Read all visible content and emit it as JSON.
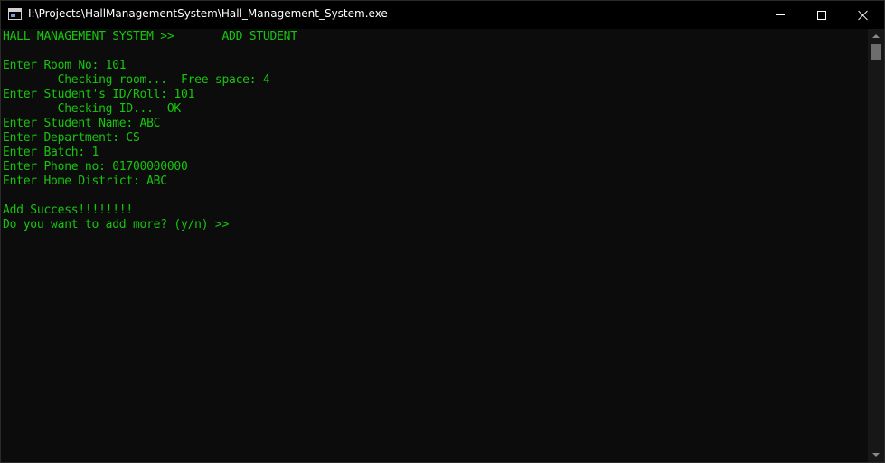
{
  "window": {
    "title": "I:\\Projects\\HallManagementSystem\\Hall_Management_System.exe",
    "icon": "console-app-icon"
  },
  "titlebar_buttons": {
    "minimize_icon": "minimize-icon",
    "maximize_icon": "maximize-icon",
    "close_icon": "close-icon"
  },
  "console": {
    "text_color": "#16c60c",
    "background_color": "#0c0c0c",
    "lines": [
      "HALL MANAGEMENT SYSTEM >>       ADD STUDENT",
      "",
      "Enter Room No: 101",
      "        Checking room...  Free space: 4",
      "Enter Student's ID/Roll: 101",
      "        Checking ID...  OK",
      "Enter Student Name: ABC",
      "Enter Department: CS",
      "Enter Batch: 1",
      "Enter Phone no: 01700000000",
      "Enter Home District: ABC",
      "",
      "Add Success!!!!!!!!",
      "Do you want to add more? (y/n) >>"
    ]
  },
  "scrollbar": {
    "up_icon": "scroll-up-arrow-icon",
    "down_icon": "scroll-down-arrow-icon"
  }
}
